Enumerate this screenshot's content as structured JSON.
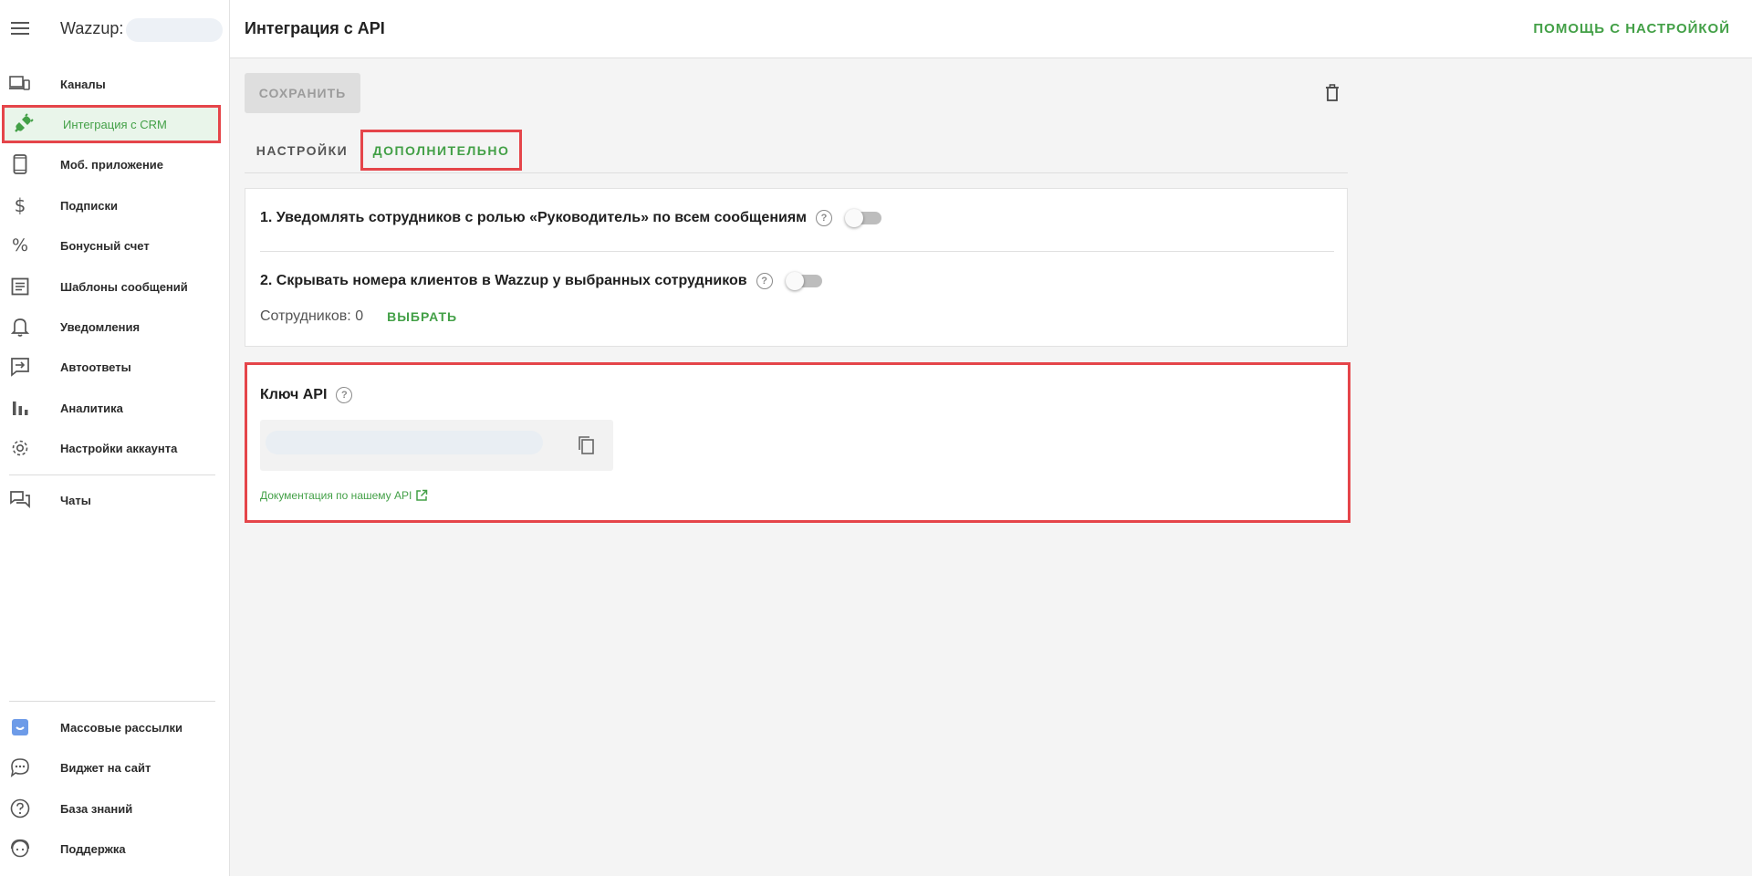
{
  "sidebar": {
    "brand_name": "Wazzup:",
    "items": [
      {
        "label": "Каналы",
        "icon": "devices-icon"
      },
      {
        "label": "Интеграция с CRM",
        "icon": "plug-icon"
      },
      {
        "label": "Моб. приложение",
        "icon": "smartphone-icon"
      },
      {
        "label": "Подписки",
        "icon": "dollar-icon"
      },
      {
        "label": "Бонусный счет",
        "icon": "percent-icon"
      },
      {
        "label": "Шаблоны сообщений",
        "icon": "document-icon"
      },
      {
        "label": "Уведомления",
        "icon": "bell-icon"
      },
      {
        "label": "Автоответы",
        "icon": "autoreply-icon"
      },
      {
        "label": "Аналитика",
        "icon": "bar-chart-icon"
      },
      {
        "label": "Настройки аккаунта",
        "icon": "gear-icon"
      },
      {
        "label": "Чаты",
        "icon": "chats-icon"
      }
    ],
    "bottom_items": [
      {
        "label": "Массовые рассылки",
        "icon": "mailing-icon"
      },
      {
        "label": "Виджет на сайт",
        "icon": "chat-bubble-icon"
      },
      {
        "label": "База знаний",
        "icon": "help-circle-icon"
      },
      {
        "label": "Поддержка",
        "icon": "support-icon"
      }
    ]
  },
  "header": {
    "title": "Интеграция с API",
    "help_link": "ПОМОЩЬ С НАСТРОЙКОЙ"
  },
  "toolbar": {
    "save_label": "СОХРАНИТЬ"
  },
  "tabs": [
    {
      "label": "НАСТРОЙКИ",
      "active": false
    },
    {
      "label": "ДОПОЛНИТЕЛЬНО",
      "active": true
    }
  ],
  "settings": {
    "notify_label": "1. Уведомлять сотрудников с ролью «Руководитель» по всем сообщениям",
    "notify_enabled": false,
    "hide_numbers_label": "2. Скрывать номера клиентов в Wazzup у выбранных сотрудников",
    "hide_numbers_enabled": false,
    "employees_text": "Сотрудников: 0",
    "choose_label": "ВЫБРАТЬ"
  },
  "api": {
    "title": "Ключ API",
    "docs_link": "Документация по нашему API"
  },
  "colors": {
    "accent": "#43a047",
    "highlight_border": "#e5454a",
    "background": "#f4f4f4"
  }
}
